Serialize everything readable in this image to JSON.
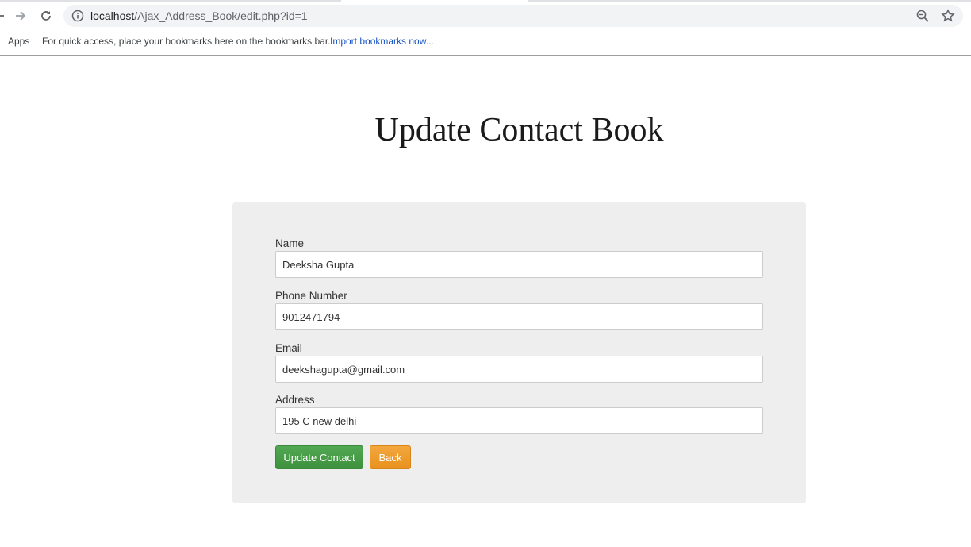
{
  "browser": {
    "url_host": "localhost",
    "url_path": "/Ajax_Address_Book/edit.php?id=1"
  },
  "bookmarks_bar": {
    "apps_label": "Apps",
    "hint": "For quick access, place your bookmarks here on the bookmarks bar.",
    "import_link": "Import bookmarks now..."
  },
  "page": {
    "title": "Update Contact Book"
  },
  "form": {
    "name_label": "Name",
    "name_value": "Deeksha Gupta",
    "phone_label": "Phone Number",
    "phone_value": "9012471794",
    "email_label": "Email",
    "email_value": "deekshagupta@gmail.com",
    "address_label": "Address",
    "address_value": "195 C new delhi",
    "update_button": "Update Contact",
    "back_button": "Back"
  },
  "colors": {
    "update_button": "#449d44",
    "back_button": "#ec971f",
    "card_background": "#eeeeee"
  }
}
